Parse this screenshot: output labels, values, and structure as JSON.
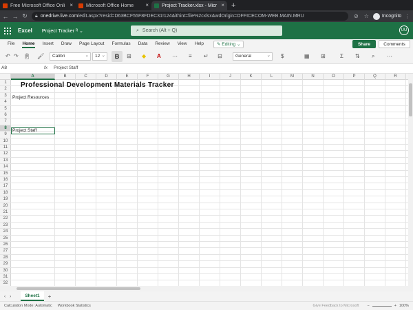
{
  "browser": {
    "tabs": [
      {
        "label": "Free Microsoft Office Onli",
        "icon_color": "#d83b01",
        "active": false
      },
      {
        "label": "Microsoft Office Home",
        "icon_color": "#d83b01",
        "active": false
      },
      {
        "label": "Project Tracker.xlsx - Micr",
        "icon_color": "#1e7145",
        "active": true
      }
    ],
    "new_tab_icon": "plus-icon",
    "url_host": "onedrive.live.com",
    "url_path": "/edit.aspx?resid=D63BCF55F8FDEC31!124&ithint=file%2cxlsx&wdOrigin=OFFICECOM-WEB.MAIN.MRU",
    "profile_label": "Incognito"
  },
  "app": {
    "name": "Excel",
    "doc_name": "Project Tracker",
    "doc_suffix": "ᴿ ⌄",
    "search_placeholder": "Search (Alt + Q)",
    "avatar_initials": "UU",
    "brand_color": "#1e7145"
  },
  "menu": {
    "items": [
      "File",
      "Home",
      "Insert",
      "Draw",
      "Page Layout",
      "Formulas",
      "Data",
      "Review",
      "View",
      "Help"
    ],
    "active": "Home",
    "editing_label": "Editing",
    "share_label": "Share",
    "comments_label": "Comments"
  },
  "ribbon": {
    "font_name": "Calibri",
    "font_size": "12",
    "bold_label": "B",
    "number_format": "General"
  },
  "formula_bar": {
    "name_box": "A8",
    "fx_label": "fx",
    "value": "Project Staff"
  },
  "grid": {
    "columns": [
      "A",
      "B",
      "C",
      "D",
      "E",
      "F",
      "G",
      "H",
      "I",
      "J",
      "K",
      "L",
      "M",
      "N",
      "O",
      "P",
      "Q",
      "R"
    ],
    "rows": [
      "1",
      "2",
      "3",
      "4",
      "5",
      "6",
      "7",
      "8",
      "9",
      "10",
      "11",
      "12",
      "13",
      "14",
      "15",
      "16",
      "17",
      "18",
      "19",
      "20",
      "21",
      "22",
      "23",
      "24",
      "25",
      "26",
      "27",
      "28",
      "29",
      "30",
      "31",
      "32"
    ],
    "selected_column": "A",
    "selected_row": "8",
    "cells": {
      "A1": "Professional Development Materials Tracker",
      "A3": "Project Resources",
      "A8": "Project Staff"
    }
  },
  "sheets": {
    "tabs": [
      "Sheet1"
    ],
    "add_label": "+"
  },
  "status": {
    "calc_mode": "Calculation Mode: Automatic",
    "workbook_stats": "Workbook Statistics",
    "feedback": "Give Feedback to Microsoft",
    "zoom": "100%"
  }
}
